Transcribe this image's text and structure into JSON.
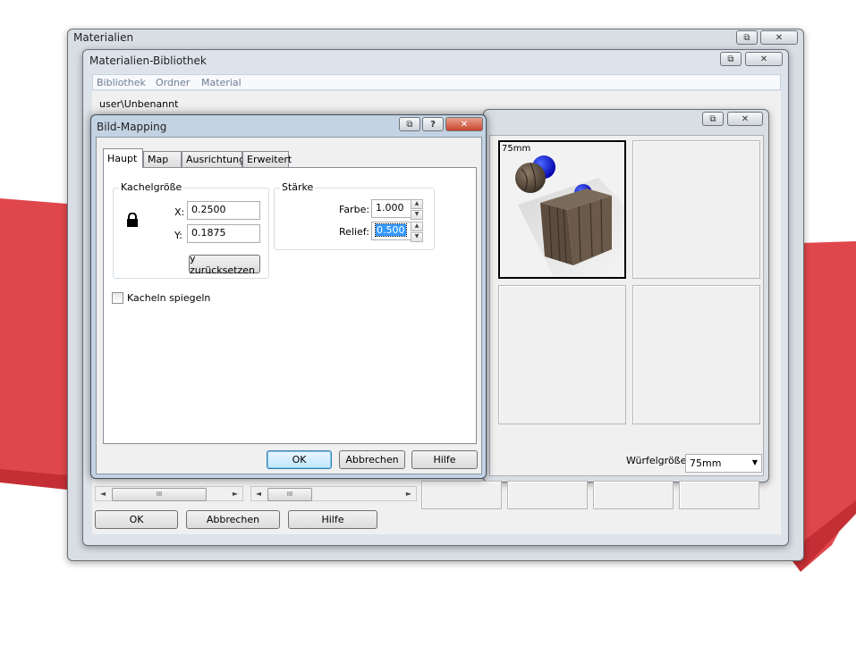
{
  "windows": {
    "materials": {
      "title": "Materialien"
    },
    "library": {
      "title": "Materialien-Bibliothek",
      "menu": [
        "Bibliothek",
        "Ordner",
        "Material"
      ],
      "path": "user\\Unbenannt",
      "cube_size_label": "Würfelgröße:",
      "cube_size_value": "75mm",
      "preview_label": "75mm",
      "buttons": {
        "ok": "OK",
        "cancel": "Abbrechen",
        "help": "Hilfe"
      },
      "scroll_thumb": "III"
    },
    "mapping": {
      "title": "Bild-Mapping",
      "tabs": [
        "Haupt",
        "Map",
        "Ausrichtung",
        "Erweitert"
      ],
      "tile_group": {
        "legend": "Kachelgröße",
        "x_label": "X:",
        "x_value": "0.2500",
        "y_label": "Y:",
        "y_value": "0.1875",
        "reset_button": "y zurücksetzen"
      },
      "strength_group": {
        "legend": "Stärke",
        "color_label": "Farbe:",
        "color_value": "1.000",
        "relief_label": "Relief:",
        "relief_value": "0.500"
      },
      "mirror_checkbox": {
        "label": "Kacheln spiegeln",
        "checked": false
      },
      "buttons": {
        "ok": "OK",
        "cancel": "Abbrechen",
        "help": "Hilfe"
      }
    }
  },
  "icons": {
    "close": "✕",
    "restore": "⧉",
    "help": "?",
    "arrow_up": "▲",
    "arrow_down": "▼",
    "arrow_left": "◄",
    "arrow_right": "►",
    "dropdown": "▼"
  },
  "colors": {
    "background_shape": "#e0474c",
    "close_button": "#c9462c",
    "selection": "#3399ff"
  }
}
